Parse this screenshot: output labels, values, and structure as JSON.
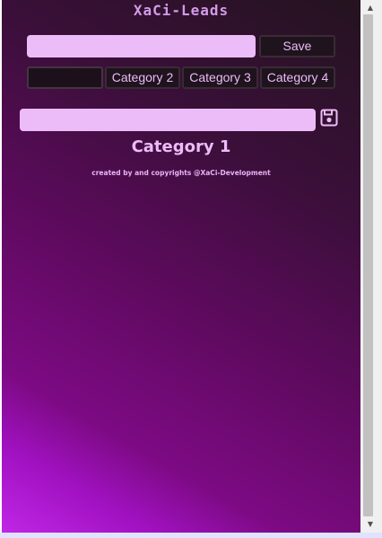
{
  "app": {
    "brand": "XaCi-Leads"
  },
  "top_row": {
    "input_value": "",
    "input_placeholder": "",
    "save_label": "Save"
  },
  "categories": [
    {
      "label": ""
    },
    {
      "label": "Category 2"
    },
    {
      "label": "Category 3"
    },
    {
      "label": "Category 4"
    }
  ],
  "entry": {
    "input_value": "",
    "input_placeholder": "",
    "save_icon": "floppy-disk-icon"
  },
  "content": {
    "category_title": "Category 1",
    "credits": "created by and copyrights @XaCi-Development"
  },
  "colors": {
    "accent": "#ecbcf8",
    "button_bg": "#1f131d",
    "gradient_light": "#c026e6",
    "gradient_dark": "#24131f"
  },
  "scrollbar": {
    "up_icon": "scroll-up-arrow-icon",
    "down_icon": "scroll-down-arrow-icon"
  }
}
